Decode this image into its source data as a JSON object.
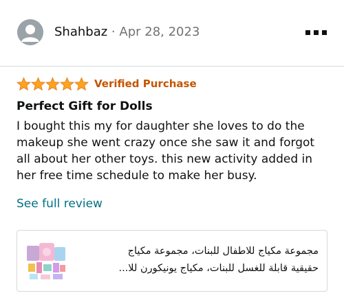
{
  "review": {
    "reviewer_name": "Shahbaz",
    "separator": "·",
    "date": "Apr 28, 2023",
    "rating_stars": 5,
    "verified_label": "Verified Purchase",
    "title": "Perfect Gift for Dolls",
    "body": "I bought this my for daughter she loves to do the makeup she went crazy once she saw it and forgot all about her other toys. this new activity added in her free time schedule to make her busy.",
    "see_full_label": "See full review"
  },
  "product": {
    "title_line1": "مجموعة مكياج للاطفال للبنات، مجموعة مكياج",
    "title_line2": "حقيقية قابلة للغسل للبنات، مكياج يونيكورن للا..."
  },
  "colors": {
    "star": "#ffa41c",
    "verified": "#c45500",
    "link": "#007185",
    "divider": "#d5d9d9"
  },
  "icons": {
    "avatar": "person-silhouette-icon",
    "more": "more-options-icon",
    "star": "star-icon"
  }
}
